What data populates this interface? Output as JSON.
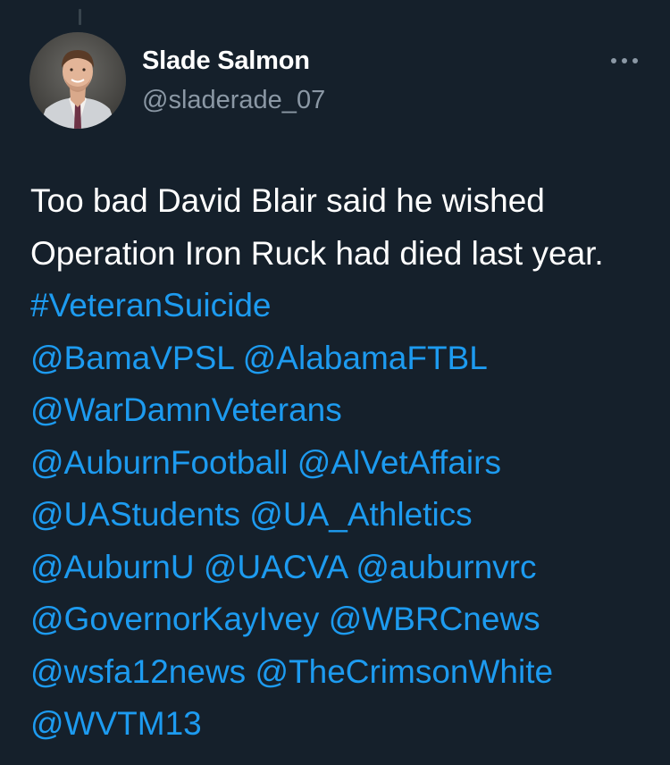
{
  "author": {
    "display_name": "Slade Salmon",
    "handle": "@sladerade_07",
    "avatar_icon": "profile-photo"
  },
  "more_menu": {
    "icon": "more-horizontal-icon"
  },
  "tweet": {
    "segments": [
      {
        "text": "Too bad David Blair said he wished Operation Iron Ruck had died last year. ",
        "type": "text"
      },
      {
        "text": "#VeteranSuicide",
        "type": "hashtag"
      },
      {
        "text": "\n",
        "type": "text"
      },
      {
        "text": "@BamaVPSL",
        "type": "mention"
      },
      {
        "text": " ",
        "type": "text"
      },
      {
        "text": "@AlabamaFTBL",
        "type": "mention"
      },
      {
        "text": "\n",
        "type": "text"
      },
      {
        "text": "@WarDamnVeterans",
        "type": "mention"
      },
      {
        "text": "\n",
        "type": "text"
      },
      {
        "text": "@AuburnFootball",
        "type": "mention"
      },
      {
        "text": " ",
        "type": "text"
      },
      {
        "text": "@AlVetAffairs",
        "type": "mention"
      },
      {
        "text": "\n",
        "type": "text"
      },
      {
        "text": "@UAStudents",
        "type": "mention"
      },
      {
        "text": " ",
        "type": "text"
      },
      {
        "text": "@UA_Athletics",
        "type": "mention"
      },
      {
        "text": "\n",
        "type": "text"
      },
      {
        "text": "@AuburnU",
        "type": "mention"
      },
      {
        "text": " ",
        "type": "text"
      },
      {
        "text": "@UACVA",
        "type": "mention"
      },
      {
        "text": " ",
        "type": "text"
      },
      {
        "text": "@auburnvrc",
        "type": "mention"
      },
      {
        "text": "\n",
        "type": "text"
      },
      {
        "text": "@GovernorKayIvey",
        "type": "mention"
      },
      {
        "text": " ",
        "type": "text"
      },
      {
        "text": "@WBRCnews",
        "type": "mention"
      },
      {
        "text": "\n",
        "type": "text"
      },
      {
        "text": "@wsfa12news",
        "type": "mention"
      },
      {
        "text": " ",
        "type": "text"
      },
      {
        "text": "@TheCrimsonWhite",
        "type": "mention"
      },
      {
        "text": "\n",
        "type": "text"
      },
      {
        "text": "@WVTM13",
        "type": "mention"
      }
    ]
  },
  "colors": {
    "background": "#15202b",
    "text": "#ffffff",
    "secondary": "#8b98a5",
    "link": "#1d9bf0"
  }
}
